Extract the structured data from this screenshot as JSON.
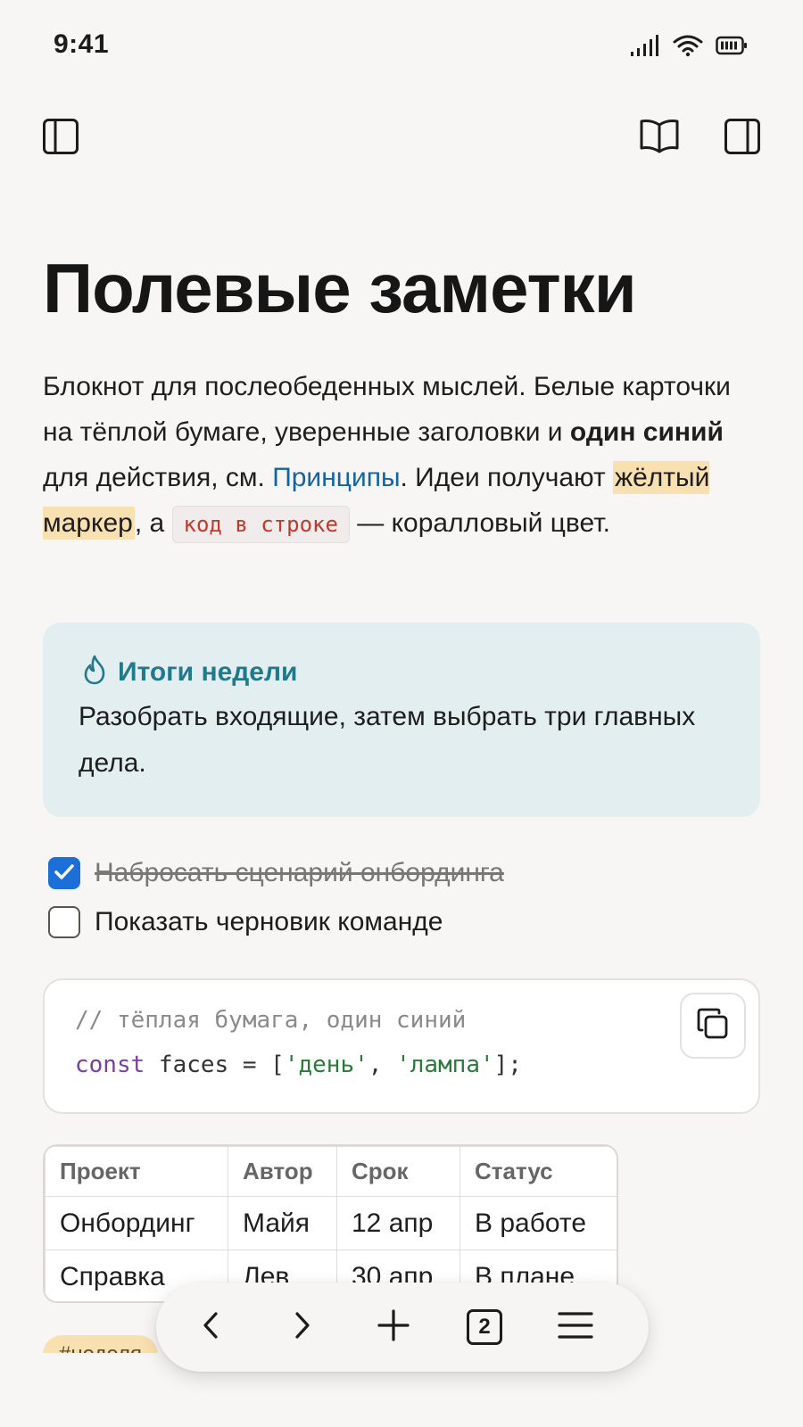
{
  "status_bar": {
    "time": "9:41"
  },
  "note": {
    "title": "Полевые заметки",
    "intro": {
      "p1": "Блокнот для послеобеденных мыслей. Белые карточки на тёплой бумаге, уверенные заголовки и ",
      "bold": "один синий",
      "p2": " для действия, см. ",
      "link": "Принципы",
      "p3": ". Идеи получают ",
      "highlight": "жёлтый маркер",
      "p4": ", а ",
      "inline_code": "код в строке",
      "p5": " — коралловый цвет."
    },
    "callout": {
      "title": "Итоги недели",
      "body": "Разобрать входящие, затем выбрать три главных дела."
    },
    "todos": [
      {
        "text": "Набросать сценарий онбординга",
        "checked": true
      },
      {
        "text": "Показать черновик команде",
        "checked": false
      }
    ],
    "code": {
      "comment": "// тёплая бумага, один синий",
      "keyword": "const",
      "ident": " faces = [",
      "str1": "'день'",
      "sep": ", ",
      "str2": "'лампа'",
      "end": "];"
    },
    "table": {
      "headers": [
        "Проект",
        "Автор",
        "Срок",
        "Статус"
      ],
      "rows": [
        [
          "Онбординг",
          "Майя",
          "12 апр",
          "В работе"
        ],
        [
          "Справка",
          "Лев",
          "30 апр",
          "В плане"
        ]
      ]
    },
    "tag": "#неделя"
  },
  "bottom_bar": {
    "tab_count": "2"
  },
  "colors": {
    "accent_blue": "#1b6fd6",
    "link": "#1264a3",
    "callout_title": "#217a8c",
    "highlight": "#f9e0b0",
    "inline_code": "#c0392b"
  }
}
